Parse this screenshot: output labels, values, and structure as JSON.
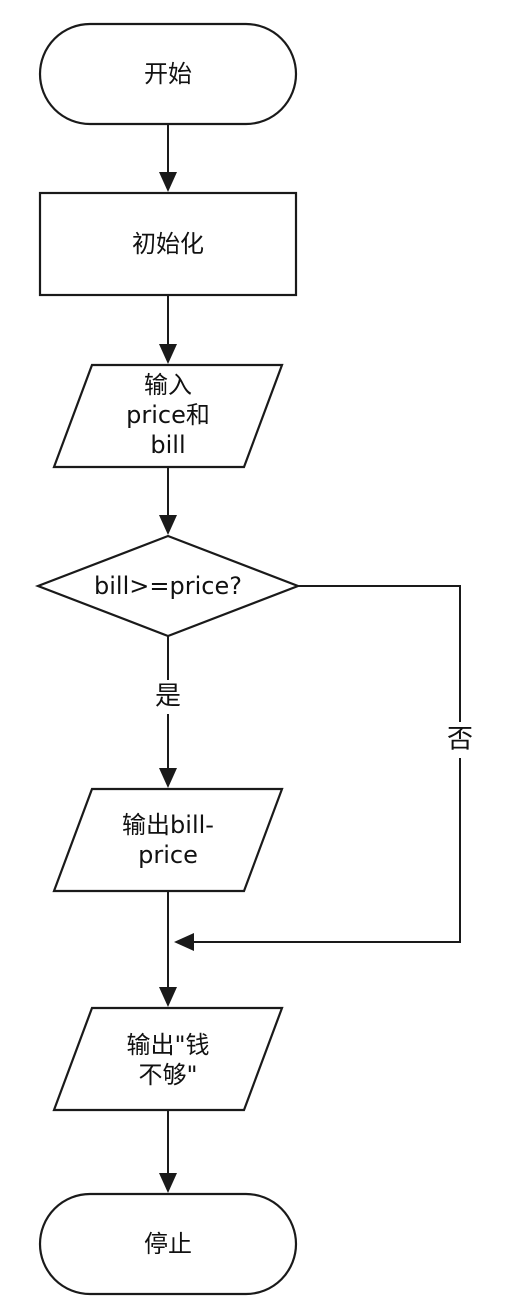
{
  "nodes": {
    "start": {
      "label": "开始"
    },
    "init": {
      "label": "初始化"
    },
    "input": {
      "lines": [
        "输入",
        "price和",
        "bill"
      ]
    },
    "decision": {
      "label": "bill>=price?"
    },
    "output_change": {
      "lines": [
        "输出bill-",
        "price"
      ]
    },
    "output_short": {
      "lines": [
        "输出\"钱",
        "不够\""
      ]
    },
    "stop": {
      "label": "停止"
    }
  },
  "edges": {
    "yes_label": "是",
    "no_label": "否"
  }
}
